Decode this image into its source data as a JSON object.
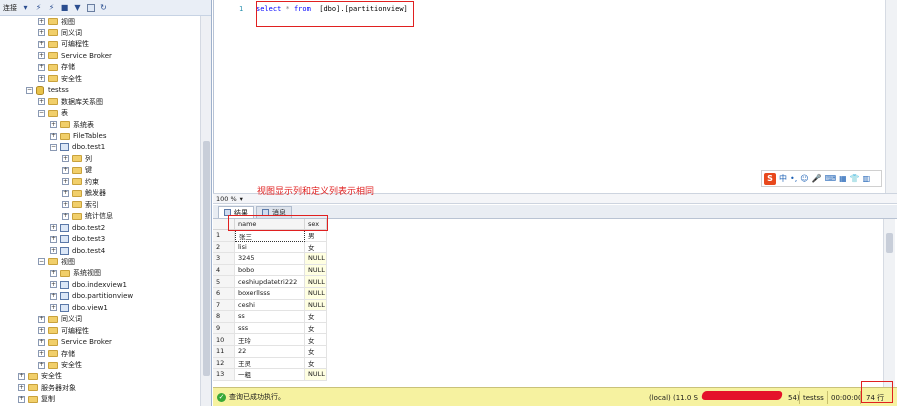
{
  "object_explorer": {
    "toolbar": {
      "connect_label": "连接"
    },
    "tree": [
      {
        "label": "视图",
        "level": 3,
        "icon": "folder",
        "exp": "+"
      },
      {
        "label": "同义词",
        "level": 3,
        "icon": "folder",
        "exp": "+"
      },
      {
        "label": "可编程性",
        "level": 3,
        "icon": "folder",
        "exp": "+"
      },
      {
        "label": "Service Broker",
        "level": 3,
        "icon": "folder",
        "exp": "+"
      },
      {
        "label": "存储",
        "level": 3,
        "icon": "folder",
        "exp": "+"
      },
      {
        "label": "安全性",
        "level": 3,
        "icon": "folder",
        "exp": "+"
      },
      {
        "label": "testss",
        "level": 2,
        "icon": "db",
        "exp": "−"
      },
      {
        "label": "数据库关系图",
        "level": 3,
        "icon": "folder",
        "exp": "+"
      },
      {
        "label": "表",
        "level": 3,
        "icon": "folder",
        "exp": "−"
      },
      {
        "label": "系统表",
        "level": 4,
        "icon": "folder",
        "exp": "+"
      },
      {
        "label": "FileTables",
        "level": 4,
        "icon": "folder",
        "exp": "+"
      },
      {
        "label": "dbo.test1",
        "level": 4,
        "icon": "table",
        "exp": "−"
      },
      {
        "label": "列",
        "level": 5,
        "icon": "folder",
        "exp": "+"
      },
      {
        "label": "键",
        "level": 5,
        "icon": "folder",
        "exp": "+"
      },
      {
        "label": "约束",
        "level": 5,
        "icon": "folder",
        "exp": "+"
      },
      {
        "label": "触发器",
        "level": 5,
        "icon": "folder",
        "exp": "+"
      },
      {
        "label": "索引",
        "level": 5,
        "icon": "folder",
        "exp": "+"
      },
      {
        "label": "统计信息",
        "level": 5,
        "icon": "folder",
        "exp": "+"
      },
      {
        "label": "dbo.test2",
        "level": 4,
        "icon": "table",
        "exp": "+"
      },
      {
        "label": "dbo.test3",
        "level": 4,
        "icon": "table",
        "exp": "+"
      },
      {
        "label": "dbo.test4",
        "level": 4,
        "icon": "table",
        "exp": "+"
      },
      {
        "label": "视图",
        "level": 3,
        "icon": "folder",
        "exp": "−"
      },
      {
        "label": "系统视图",
        "level": 4,
        "icon": "folder",
        "exp": "+"
      },
      {
        "label": "dbo.indexview1",
        "level": 4,
        "icon": "table",
        "exp": "+"
      },
      {
        "label": "dbo.partitionview",
        "level": 4,
        "icon": "table",
        "exp": "+"
      },
      {
        "label": "dbo.view1",
        "level": 4,
        "icon": "table",
        "exp": "+"
      },
      {
        "label": "同义词",
        "level": 3,
        "icon": "folder",
        "exp": "+"
      },
      {
        "label": "可编程性",
        "level": 3,
        "icon": "folder",
        "exp": "+"
      },
      {
        "label": "Service Broker",
        "level": 3,
        "icon": "folder",
        "exp": "+"
      },
      {
        "label": "存储",
        "level": 3,
        "icon": "folder",
        "exp": "+"
      },
      {
        "label": "安全性",
        "level": 3,
        "icon": "folder",
        "exp": "+"
      },
      {
        "label": "安全性",
        "level": 1,
        "icon": "folder",
        "exp": "+"
      },
      {
        "label": "服务器对象",
        "level": 1,
        "icon": "folder",
        "exp": "+"
      },
      {
        "label": "复制",
        "level": 1,
        "icon": "folder",
        "exp": "+"
      }
    ]
  },
  "editor": {
    "line_number": "1",
    "code": {
      "kw1": "select",
      "star": "*",
      "kw2": "from",
      "obj": "[dbo].[partitionview]"
    },
    "annotation": "视图显示列和定义列表示相同",
    "ime": {
      "logo": "S",
      "lang": "中",
      "punct": "•,"
    }
  },
  "zoom": {
    "value": "100 %"
  },
  "results": {
    "tabs": [
      {
        "label": "结果"
      },
      {
        "label": "消息"
      }
    ],
    "columns": [
      "name",
      "sex"
    ],
    "rows": [
      [
        "1",
        "张三",
        "男"
      ],
      [
        "2",
        "lisi",
        "女"
      ],
      [
        "3",
        "3245",
        "NULL"
      ],
      [
        "4",
        "bobo",
        "NULL"
      ],
      [
        "5",
        "ceshiupdatetri222",
        "NULL"
      ],
      [
        "6",
        "boxerllsss",
        "NULL"
      ],
      [
        "7",
        "ceshi",
        "NULL"
      ],
      [
        "8",
        "ss",
        "女"
      ],
      [
        "9",
        "sss",
        "女"
      ],
      [
        "10",
        "王玲",
        "女"
      ],
      [
        "11",
        "22",
        "女"
      ],
      [
        "12",
        "王灵",
        "女"
      ],
      [
        "13",
        "一粗",
        "NULL"
      ]
    ]
  },
  "status": {
    "message": "查询已成功执行。",
    "server": "(local) (11.0 S",
    "user_tail": "54)",
    "database": "testss",
    "time": "00:00:00",
    "rows": "74 行"
  }
}
